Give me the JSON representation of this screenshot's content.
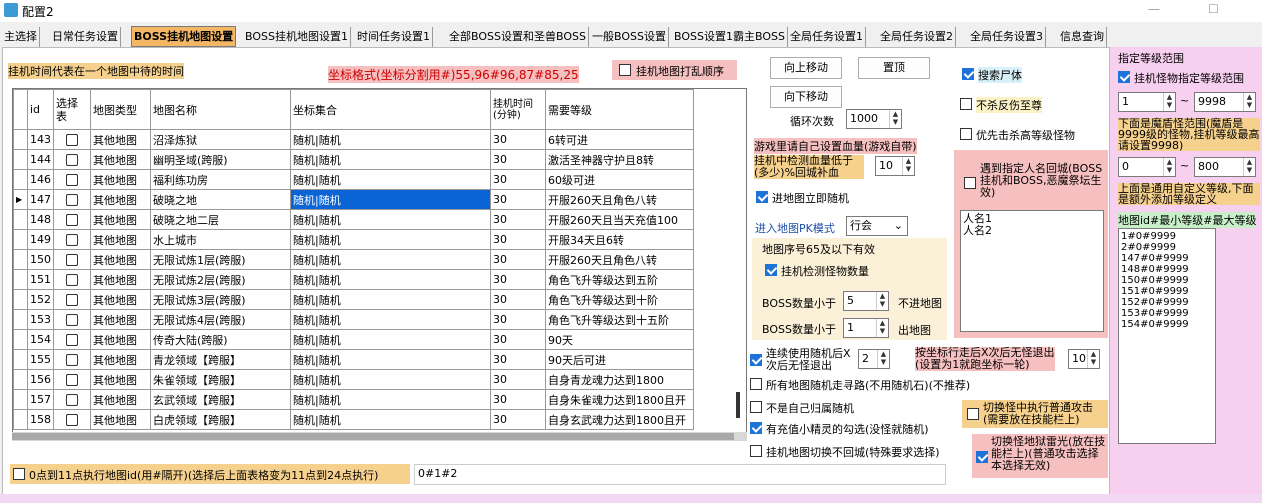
{
  "window": {
    "title": "配置2"
  },
  "tabs": [
    "主选择",
    "日常任务设置",
    "BOSS挂机地图设置",
    "BOSS挂机地图设置1",
    "时间任务设置1",
    "全部BOSS设置和圣兽BOSS",
    "一般BOSS设置",
    "BOSS设置1霸主BOSS",
    "全局任务设置1",
    "全局任务设置2",
    "全局任务设置3",
    "信息查询"
  ],
  "labels": {
    "hint_time": "挂机时间代表在一个地图中待的时间",
    "coord_format": "坐标格式(坐标分割用#)55,96#96,87#85,25",
    "shuffle": "挂机地图打乱顺序",
    "loop_count": "循环次数",
    "set_hp_hint": "游戏里请自己设置血量(游戏自带)",
    "detect_hp_low": "挂机中检测血量低于(多少)%回城补血",
    "enter_random": "进地图立即随机",
    "pk_mode": "进入地图PK模式",
    "map_seq_hint": "地图序号65及以下有效",
    "detect_monster_count": "挂机检测怪物数量",
    "boss_count_less1": "BOSS数量小于",
    "not_enter_map": "不进地图",
    "boss_count_less2": "BOSS数量小于",
    "exit_map": "出地图",
    "search_corpse": "搜索尸体",
    "no_kill_revenge": "不杀反伤至尊",
    "prefer_high_level": "优先击杀高等级怪物",
    "meet_name_return": "遇到指定人名回城(BOSS挂机和BOSS,恶魔祭坛生效)",
    "continuous_random": "连续使用随机后X次后无怪退出",
    "walk_no_monster": "按坐标行走后X次后无怪退出(设置为1就跑坐标一轮)",
    "all_map_walk": "所有地图随机走寻路(不用随机石)(不推荐)",
    "not_own_random": "不是自己归属随机",
    "has_value_sprite": "有充值小精灵的勾选(没怪就随机)",
    "switch_no_return": "挂机地图切换不回城(特殊要求选择)",
    "switch_normal_attack": "切换怪中执行普通攻击(需要放在技能栏上)",
    "switch_thunder": "切换怪地狱雷光(放在技能栏上)(普通攻击选择本选择无效)",
    "schedule": "0点到11点执行地图id(用#隔开)(选择后上面表格变为11点到24点执行)",
    "level_range_title": "指定等级范围",
    "level_range_cb": "挂机怪物指定等级范围",
    "demon_hint": "下面是魔盾怪范围(魔盾是9999级的怪物,挂机等级最高请设置9998)",
    "custom_hint": "上面是通用自定义等级,下面是额外添加等级定义",
    "map_level_hint": "地图id#最小等级#最大等级",
    "tilde1": "~",
    "tilde2": "~"
  },
  "buttons": {
    "move_up": "向上移动",
    "top": "置顶",
    "move_down": "向下移动"
  },
  "inputs": {
    "loop_count": "1000",
    "hp_percent": "10",
    "pk_mode": "行会",
    "boss_less1": "5",
    "boss_less2": "1",
    "random_times": "2",
    "walk_times": "10",
    "level_min": "1",
    "level_max": "9998",
    "demon_min": "0",
    "demon_max": "800",
    "schedule": "0#1#2"
  },
  "checks": {
    "shuffle": false,
    "enter_random": true,
    "detect_monster_count": true,
    "search_corpse": true,
    "no_kill_revenge": false,
    "prefer_high_level": false,
    "meet_name_return": false,
    "continuous_random": true,
    "all_map_walk": false,
    "not_own_random": false,
    "has_value_sprite": true,
    "switch_no_return": false,
    "switch_normal_attack": false,
    "switch_thunder": true,
    "schedule": false,
    "level_range": true
  },
  "names_list": [
    "人名1",
    "人名2"
  ],
  "map_levels": [
    "1#0#9999",
    "2#0#9999",
    "147#0#9999",
    "148#0#9999",
    "150#0#9999",
    "151#0#9999",
    "152#0#9999",
    "153#0#9999",
    "154#0#9999"
  ],
  "table": {
    "headers": [
      "id",
      "选择表",
      "地图类型",
      "地图名称",
      "坐标集合",
      "挂机时间(分钟)",
      "需要等级"
    ],
    "rows": [
      [
        "143",
        "",
        "其他地图",
        "沼泽炼狱",
        "随机|随机",
        "30",
        "6转可进"
      ],
      [
        "144",
        "",
        "其他地图",
        "幽明圣域(跨服)",
        "随机|随机",
        "30",
        "激活圣神器守护且8转"
      ],
      [
        "146",
        "",
        "其他地图",
        "福利练功房",
        "随机|随机",
        "30",
        "60级可进"
      ],
      [
        "147",
        "",
        "其他地图",
        "破晓之地",
        "随机|随机",
        "30",
        "开服260天且角色八转"
      ],
      [
        "148",
        "",
        "其他地图",
        "破晓之地二层",
        "随机|随机",
        "30",
        "开服260天且当天充值100"
      ],
      [
        "149",
        "",
        "其他地图",
        "水上城市",
        "随机|随机",
        "30",
        "开服34天且6转"
      ],
      [
        "150",
        "",
        "其他地图",
        "无限试炼1层(跨服)",
        "随机|随机",
        "30",
        "开服260天且角色八转"
      ],
      [
        "151",
        "",
        "其他地图",
        "无限试炼2层(跨服)",
        "随机|随机",
        "30",
        "角色飞升等级达到五阶"
      ],
      [
        "152",
        "",
        "其他地图",
        "无限试炼3层(跨服)",
        "随机|随机",
        "30",
        "角色飞升等级达到十阶"
      ],
      [
        "153",
        "",
        "其他地图",
        "无限试炼4层(跨服)",
        "随机|随机",
        "30",
        "角色飞升等级达到十五阶"
      ],
      [
        "154",
        "",
        "其他地图",
        "传奇大陆(跨服)",
        "随机|随机",
        "30",
        "90天"
      ],
      [
        "155",
        "",
        "其他地图",
        "青龙领域【跨服】",
        "随机|随机",
        "30",
        "90天后可进"
      ],
      [
        "156",
        "",
        "其他地图",
        "朱雀领域【跨服】",
        "随机|随机",
        "30",
        "自身青龙魂力达到1800"
      ],
      [
        "157",
        "",
        "其他地图",
        "玄武领域【跨服】",
        "随机|随机",
        "30",
        "自身朱雀魂力达到1800且开"
      ],
      [
        "158",
        "",
        "其他地图",
        "白虎领域【跨服】",
        "随机|随机",
        "30",
        "自身玄武魂力达到1800且开"
      ]
    ]
  }
}
